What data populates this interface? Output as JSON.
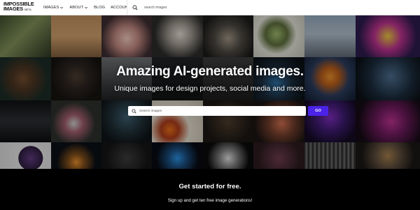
{
  "header": {
    "logo_line1": "IMPOSSIBLE",
    "logo_line2": "IMAGES",
    "logo_badge": "BETA",
    "nav": [
      {
        "label": "IMAGES",
        "dropdown": true
      },
      {
        "label": "ABOUT",
        "dropdown": true
      },
      {
        "label": "BLOG",
        "dropdown": false
      },
      {
        "label": "ACCOUNT",
        "dropdown": false
      }
    ],
    "search_placeholder": "search images"
  },
  "hero": {
    "title": "Amazing AI-generated images.",
    "subtitle": "Unique images for design projects, social media and more.",
    "search_placeholder": "Search images",
    "go_label": "GO"
  },
  "cta": {
    "title": "Get started for free.",
    "subtitle": "Sign up and get ten free image generations!"
  },
  "colors": {
    "accent": "#4b23e8",
    "background": "#000000",
    "header_bg": "#ffffff"
  },
  "icons": {
    "header_search": "search-icon",
    "hero_search": "search-icon",
    "dropdown": "chevron-down-icon"
  }
}
